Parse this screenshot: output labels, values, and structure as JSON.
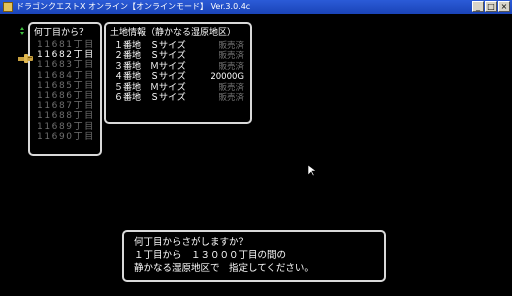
{
  "window": {
    "title": "ドラゴンクエストX オンライン【オンラインモード】 Ver.3.0.4c",
    "buttons": [
      "_",
      "□",
      "×"
    ]
  },
  "street_window": {
    "title": "何丁目から？",
    "items": [
      "11681丁目",
      "11682丁目",
      "11683丁目",
      "11684丁目",
      "11685丁目",
      "11686丁目",
      "11687丁目",
      "11688丁目",
      "11689丁目",
      "11690丁目"
    ],
    "selected_index": 1
  },
  "land_window": {
    "title": "土地情報（静かなる湿原地区）",
    "rows": [
      {
        "lot": "１番地",
        "size": "Ｓサイズ",
        "status": "販売済"
      },
      {
        "lot": "２番地",
        "size": "Ｓサイズ",
        "status": "販売済"
      },
      {
        "lot": "３番地",
        "size": "Ｍサイズ",
        "status": "販売済"
      },
      {
        "lot": "４番地",
        "size": "Ｓサイズ",
        "status": "20000G"
      },
      {
        "lot": "５番地",
        "size": "Ｍサイズ",
        "status": "販売済"
      },
      {
        "lot": "６番地",
        "size": "Ｓサイズ",
        "status": "販売済"
      }
    ]
  },
  "message": {
    "lines": [
      "何丁目からさがしますか？",
      "１丁目から　１３０００丁目の間の",
      "静かなる湿原地区で　指定してください。"
    ]
  },
  "colors": {
    "titlebar": "#2458d0",
    "border": "#d9d9d9",
    "text": "#ffffff",
    "dim_text": "#6f6f6f",
    "cursor": "#c8a040",
    "scroll_arrow": "#3fbf3f"
  }
}
